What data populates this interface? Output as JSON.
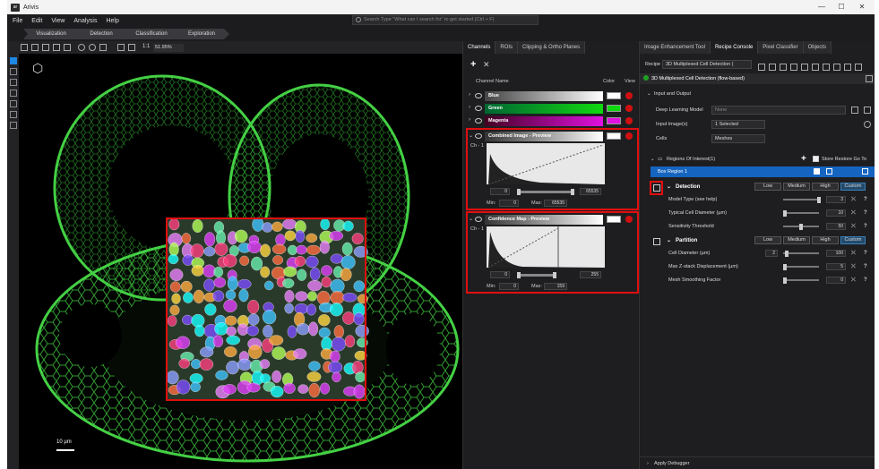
{
  "app": {
    "title": "Arivis"
  },
  "window_controls": [
    "—",
    "☐",
    "✕"
  ],
  "menu": [
    "File",
    "Edit",
    "View",
    "Analysis",
    "Help"
  ],
  "search": {
    "placeholder": "Search  Type \"What can I search for\" to get started (Ctrl + F)"
  },
  "workflow": [
    "Visualization",
    "Detection",
    "Classification",
    "Exploration"
  ],
  "viewer": {
    "zoom_ratio": "1:1",
    "zoom": "51.95%",
    "scalebar": "10 µm"
  },
  "channels_panel": {
    "tabs": [
      "Channels",
      "ROIs",
      "Clipping & Ortho Planes"
    ],
    "header": {
      "name": "Channel Name",
      "color": "Color",
      "view": "View"
    },
    "channels": [
      {
        "name": "Blue",
        "color": "#ffffff"
      },
      {
        "name": "Green",
        "color": "#10d810"
      },
      {
        "name": "Magenta",
        "color": "#e010e0"
      }
    ],
    "combined": {
      "name": "Combined Image - Preview",
      "ch": "Ch - 1",
      "min_label": "Min:",
      "max_label": "Max:",
      "slider_min": "0",
      "slider_max": "65535",
      "min": "0",
      "max": "65535"
    },
    "confidence": {
      "name": "Confidence Map - Preview",
      "ch": "Ch - 1",
      "min_label": "Min:",
      "max_label": "Max:",
      "slider_min": "0",
      "slider_max": "255",
      "min": "0",
      "max": "159"
    }
  },
  "right_panel": {
    "tabs": [
      "Image Enhancement Tool",
      "Recipe Console",
      "Pixel Classifier",
      "Objects"
    ],
    "recipe_label": "Recipe",
    "recipe_value": "3D Multiplexed Cell Detection (",
    "recipe_title": "3D Multiplexed Cell Detection (flow-based)",
    "io_section": "Input and Output",
    "deep_learning_label": "Deep Learning Model",
    "deep_learning_value": "None",
    "input_images_label": "Input Image(s)",
    "input_images_value": "1 Selected",
    "cells_label": "Cells",
    "cells_value": "Meshes",
    "roi_title": "Regions Of Interest(1)",
    "roi_actions": "Store  Restore  Go To",
    "roi_item": "Box Region 1",
    "detection": {
      "title": "Detection",
      "presets": [
        "Low",
        "Medium",
        "High",
        "Custom"
      ],
      "params": [
        {
          "label": "Model Type (see help)",
          "value": "3"
        },
        {
          "label": "Typical Cell Diameter (µm)",
          "value": "10"
        },
        {
          "label": "Sensitivity Threshold",
          "value": "50"
        }
      ]
    },
    "partition": {
      "title": "Partition",
      "presets": [
        "Low",
        "Medium",
        "High",
        "Custom"
      ],
      "params": [
        {
          "label": "Cell Diameter (µm)",
          "value": "2",
          "value2": "100"
        },
        {
          "label": "Max Z-stack Displacement (µm)",
          "value": "5"
        },
        {
          "label": "Mesh Smoothing Factor",
          "value": "0"
        }
      ]
    },
    "footer": "Apply Debugger"
  }
}
